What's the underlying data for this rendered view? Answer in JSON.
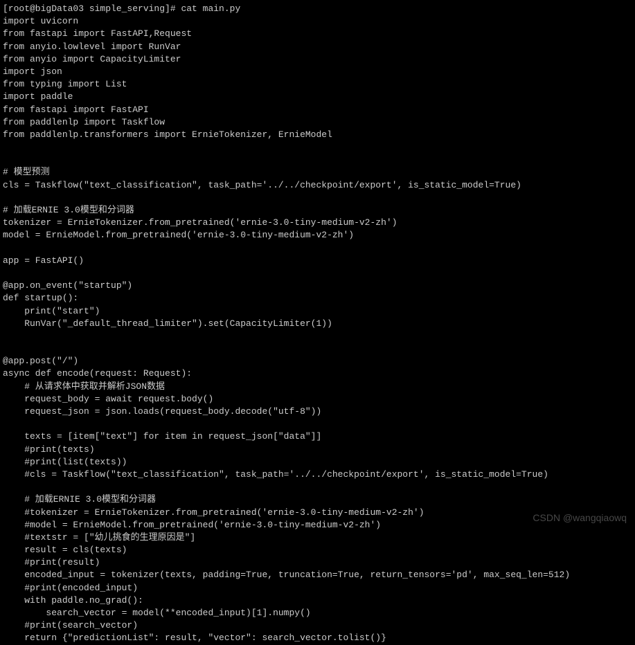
{
  "prompt": "[root@bigData03 simple_serving]# cat main.py",
  "lines": [
    "import uvicorn",
    "from fastapi import FastAPI,Request",
    "from anyio.lowlevel import RunVar",
    "from anyio import CapacityLimiter",
    "import json",
    "from typing import List",
    "import paddle",
    "from fastapi import FastAPI",
    "from paddlenlp import Taskflow",
    "from paddlenlp.transformers import ErnieTokenizer, ErnieModel",
    "",
    "",
    "# 模型预测",
    "cls = Taskflow(\"text_classification\", task_path='../../checkpoint/export', is_static_model=True)",
    "",
    "# 加载ERNIE 3.0模型和分词器",
    "tokenizer = ErnieTokenizer.from_pretrained('ernie-3.0-tiny-medium-v2-zh')",
    "model = ErnieModel.from_pretrained('ernie-3.0-tiny-medium-v2-zh')",
    "",
    "app = FastAPI()",
    "",
    "@app.on_event(\"startup\")",
    "def startup():",
    "    print(\"start\")",
    "    RunVar(\"_default_thread_limiter\").set(CapacityLimiter(1))",
    "",
    "",
    "@app.post(\"/\")",
    "async def encode(request: Request):",
    "    # 从请求体中获取并解析JSON数据",
    "    request_body = await request.body()",
    "    request_json = json.loads(request_body.decode(\"utf-8\"))",
    "",
    "    texts = [item[\"text\"] for item in request_json[\"data\"]]",
    "    #print(texts)",
    "    #print(list(texts))",
    "    #cls = Taskflow(\"text_classification\", task_path='../../checkpoint/export', is_static_model=True)",
    "",
    "    # 加载ERNIE 3.0模型和分词器",
    "    #tokenizer = ErnieTokenizer.from_pretrained('ernie-3.0-tiny-medium-v2-zh')",
    "    #model = ErnieModel.from_pretrained('ernie-3.0-tiny-medium-v2-zh')",
    "    #textstr = [\"幼儿挑食的生理原因是\"]",
    "    result = cls(texts)",
    "    #print(result)",
    "    encoded_input = tokenizer(texts, padding=True, truncation=True, return_tensors='pd', max_seq_len=512)",
    "    #print(encoded_input)",
    "    with paddle.no_grad():",
    "        search_vector = model(**encoded_input)[1].numpy()",
    "    #print(search_vector)",
    "    return {\"predictionList\": result, \"vector\": search_vector.tolist()}"
  ],
  "watermark": "CSDN @wangqiaowq"
}
